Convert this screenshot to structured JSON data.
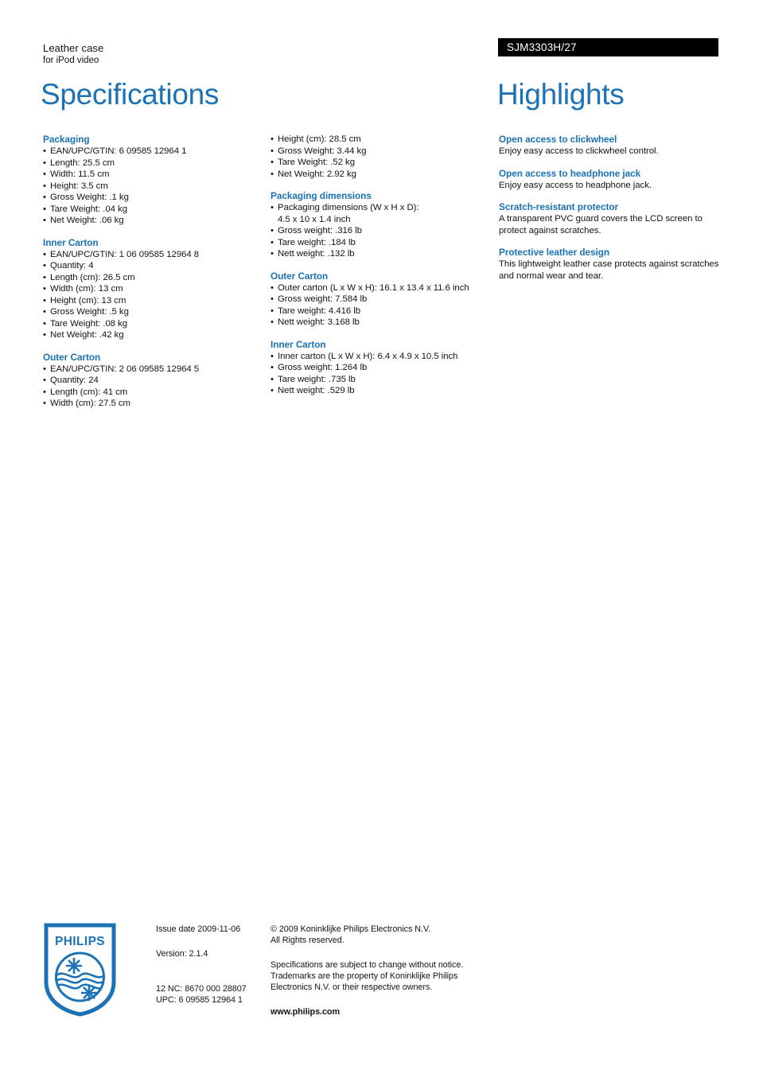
{
  "header": {
    "product_title": "Leather case",
    "product_subtitle": "for iPod video",
    "product_code": "SJM3303H/27",
    "left_heading": "Specifications",
    "right_heading": "Highlights"
  },
  "colors": {
    "philips_blue": "#1b72b5",
    "banner_bg": "#000000",
    "banner_text": "#ffffff",
    "body_text": "#141414"
  },
  "specifications": {
    "column1": [
      {
        "heading": "Packaging",
        "items": [
          "EAN/UPC/GTIN: 6 09585 12964 1",
          "Length: 25.5 cm",
          "Width: 11.5 cm",
          "Height: 3.5 cm",
          "Gross Weight: .1 kg",
          "Tare Weight: .04 kg",
          "Net Weight: .06 kg"
        ]
      },
      {
        "heading": "Inner Carton",
        "items": [
          "EAN/UPC/GTIN: 1 06 09585 12964 8",
          "Quantity: 4",
          "Length (cm): 26.5 cm",
          "Width (cm): 13 cm",
          "Height (cm): 13 cm",
          "Gross Weight: .5 kg",
          "Tare Weight: .08 kg",
          "Net Weight: .42 kg"
        ]
      },
      {
        "heading": "Outer Carton",
        "items": [
          "EAN/UPC/GTIN: 2 06 09585 12964 5",
          "Quantity: 24",
          "Length (cm): 41 cm",
          "Width (cm): 27.5 cm"
        ]
      }
    ],
    "column2": [
      {
        "heading": "",
        "items": [
          "Height (cm): 28.5 cm",
          "Gross Weight: 3.44 kg",
          "Tare Weight: .52 kg",
          "Net Weight: 2.92 kg"
        ]
      },
      {
        "heading": "Packaging dimensions",
        "items": [
          "Packaging dimensions (W x H x D):",
          "Gross weight: .316 lb",
          "Tare weight: .184 lb",
          "Nett weight: .132 lb"
        ],
        "item0_continuation": "4.5 x 10 x 1.4 inch"
      },
      {
        "heading": "Outer Carton",
        "items": [
          "Outer carton (L x W x H): 16.1 x 13.4 x 11.6 inch",
          "Gross weight: 7.584 lb",
          "Tare weight: 4.416 lb",
          "Nett weight: 3.168 lb"
        ]
      },
      {
        "heading": "Inner Carton",
        "items": [
          "Inner carton (L x W x H): 6.4 x 4.9 x 10.5 inch",
          "Gross weight: 1.264 lb",
          "Tare weight: .735 lb",
          "Nett weight: .529 lb"
        ]
      }
    ]
  },
  "highlights": [
    {
      "heading": "Open access to clickwheel",
      "body": "Enjoy easy access to clickwheel control."
    },
    {
      "heading": "Open access to headphone jack",
      "body": "Enjoy easy access to headphone jack."
    },
    {
      "heading": "Scratch-resistant protector",
      "body": "A transparent PVC guard covers the LCD screen to protect against scratches."
    },
    {
      "heading": "Protective leather design",
      "body": "This lightweight leather case protects against scratches and normal wear and tear."
    }
  ],
  "footer": {
    "logo_wordmark": "PHILIPS",
    "issue_date": "Issue date 2009-11-06",
    "version": "Version: 2.1.4",
    "twelve_nc": "12 NC: 8670 000 28807",
    "upc": "UPC: 6 09585 12964 1",
    "copyright_line1": "© 2009 Koninklijke Philips Electronics N.V.",
    "copyright_line2": "All Rights reserved.",
    "disclaimer": "Specifications are subject to change without notice. Trademarks are the property of Koninklijke Philips Electronics N.V. or their respective owners.",
    "website": "www.philips.com"
  }
}
